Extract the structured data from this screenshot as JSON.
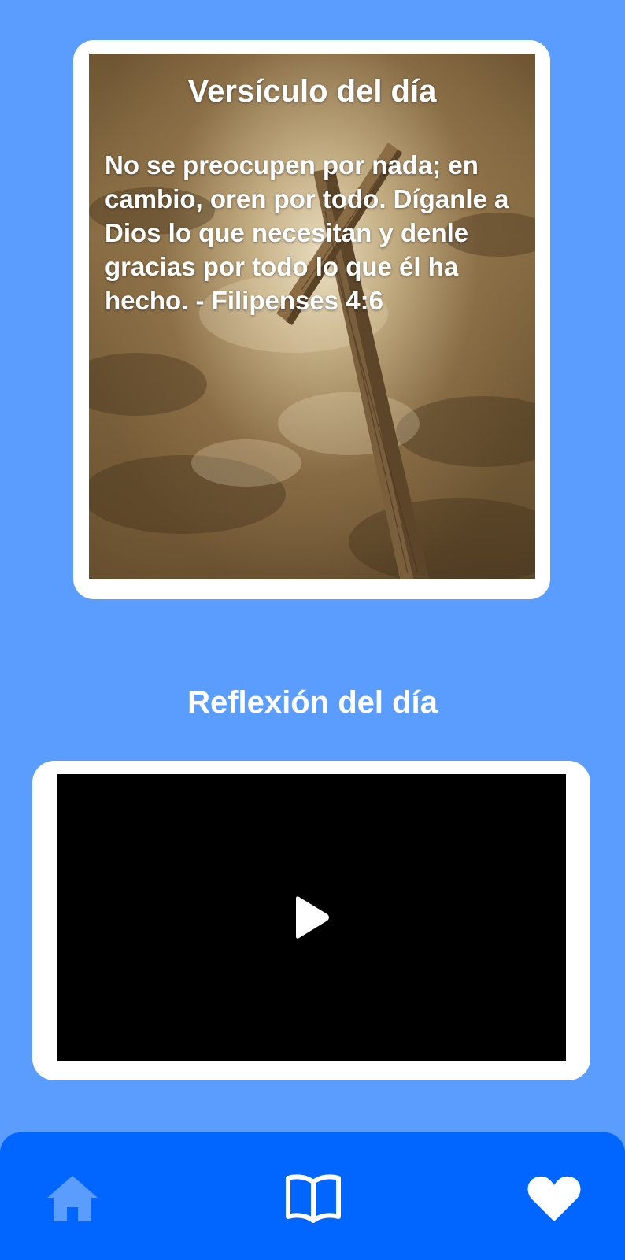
{
  "verse_card": {
    "title": "Versículo del día",
    "text": "No se preocupen por nada; en cambio, oren por todo. Díganle a Dios lo que necesitan y denle gracias por todo lo que él ha hecho. - Filipenses 4:6",
    "background": "cross-sky-image"
  },
  "reflection": {
    "title": "Reflexión del día",
    "video": {
      "icon": "play-icon"
    }
  },
  "bottom_nav": {
    "items": [
      {
        "icon": "home-icon",
        "color": "#5b9dff"
      },
      {
        "icon": "book-open-icon",
        "color": "#ffffff"
      },
      {
        "icon": "heart-icon",
        "color": "#ffffff"
      }
    ]
  },
  "colors": {
    "background": "#5b9dff",
    "nav_background": "#0066ff",
    "card": "#ffffff",
    "video": "#000000"
  }
}
